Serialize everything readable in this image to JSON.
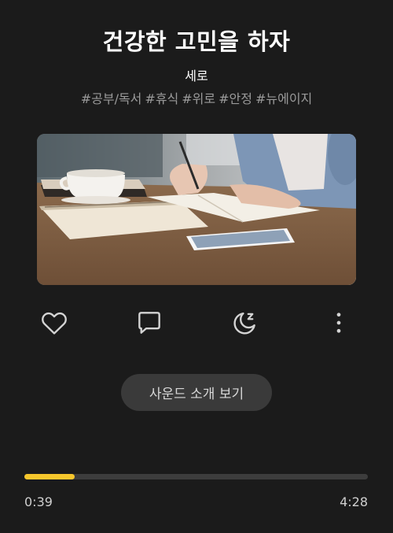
{
  "track": {
    "title": "건강한 고민을 하자",
    "artist": "세로",
    "tags": [
      "#공부/독서",
      "#휴식",
      "#위로",
      "#안정",
      "#뉴에이지"
    ]
  },
  "cover_image": {
    "description_icon": "study-desk-photo"
  },
  "actions": {
    "like_icon": "heart-icon",
    "comment_icon": "comment-icon",
    "sleep_icon": "sleep-moon-icon",
    "more_icon": "more-vertical-icon"
  },
  "intro_button": {
    "label": "사운드 소개 보기"
  },
  "player": {
    "progress_fraction": 0.147,
    "current_time": "0:39",
    "total_time": "4:28",
    "accent_color": "#f6c62c"
  }
}
